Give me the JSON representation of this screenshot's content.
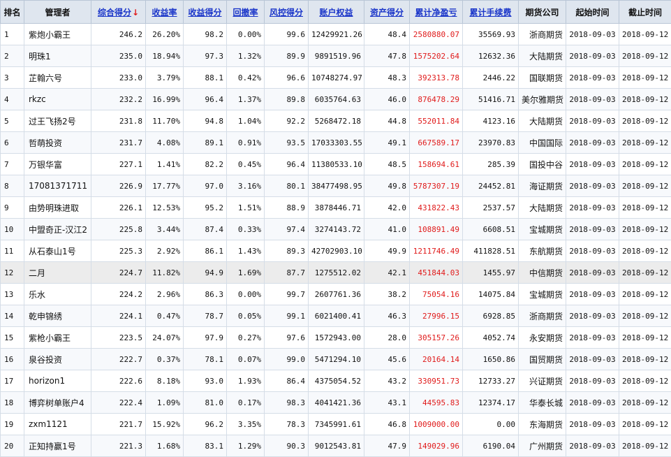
{
  "headers": [
    "排名",
    "管理者",
    "综合得分",
    "收益率",
    "收益得分",
    "回撤率",
    "风控得分",
    "账户权益",
    "资产得分",
    "累计净盈亏",
    "累计手续费",
    "期货公司",
    "起始时间",
    "截止时间"
  ],
  "sort_indicator": "↓",
  "rows": [
    {
      "rank": "1",
      "name": "紫炮小霸王",
      "score": "246.2",
      "ret": "26.20%",
      "ret_score": "98.2",
      "dd": "0.00%",
      "risk": "99.6",
      "equity": "12429921.26",
      "asset": "48.4",
      "pnl": "2580880.07",
      "fee": "35569.93",
      "company": "浙商期货",
      "start": "2018-09-03",
      "end": "2018-09-12"
    },
    {
      "rank": "2",
      "name": "明珠1",
      "score": "235.0",
      "ret": "18.94%",
      "ret_score": "97.3",
      "dd": "1.32%",
      "risk": "89.9",
      "equity": "9891519.96",
      "asset": "47.8",
      "pnl": "1575202.64",
      "fee": "12632.36",
      "company": "大陆期货",
      "start": "2018-09-03",
      "end": "2018-09-12"
    },
    {
      "rank": "3",
      "name": "芷翰六号",
      "score": "233.0",
      "ret": "3.79%",
      "ret_score": "88.1",
      "dd": "0.42%",
      "risk": "96.6",
      "equity": "10748274.97",
      "asset": "48.3",
      "pnl": "392313.78",
      "fee": "2446.22",
      "company": "国联期货",
      "start": "2018-09-03",
      "end": "2018-09-12"
    },
    {
      "rank": "4",
      "name": "rkzc",
      "score": "232.2",
      "ret": "16.99%",
      "ret_score": "96.4",
      "dd": "1.37%",
      "risk": "89.8",
      "equity": "6035764.63",
      "asset": "46.0",
      "pnl": "876478.29",
      "fee": "51416.71",
      "company": "美尔雅期货",
      "start": "2018-09-03",
      "end": "2018-09-12"
    },
    {
      "rank": "5",
      "name": "过王飞扬2号",
      "score": "231.8",
      "ret": "11.70%",
      "ret_score": "94.8",
      "dd": "1.04%",
      "risk": "92.2",
      "equity": "5268472.18",
      "asset": "44.8",
      "pnl": "552011.84",
      "fee": "4123.16",
      "company": "大陆期货",
      "start": "2018-09-03",
      "end": "2018-09-12"
    },
    {
      "rank": "6",
      "name": "哲萌投资",
      "score": "231.7",
      "ret": "4.08%",
      "ret_score": "89.1",
      "dd": "0.91%",
      "risk": "93.5",
      "equity": "17033303.55",
      "asset": "49.1",
      "pnl": "667589.17",
      "fee": "23970.83",
      "company": "中国国际",
      "start": "2018-09-03",
      "end": "2018-09-12"
    },
    {
      "rank": "7",
      "name": "万银华富",
      "score": "227.1",
      "ret": "1.41%",
      "ret_score": "82.2",
      "dd": "0.45%",
      "risk": "96.4",
      "equity": "11380533.10",
      "asset": "48.5",
      "pnl": "158694.61",
      "fee": "285.39",
      "company": "国投中谷",
      "start": "2018-09-03",
      "end": "2018-09-12"
    },
    {
      "rank": "8",
      "name": "17081371711",
      "score": "226.9",
      "ret": "17.77%",
      "ret_score": "97.0",
      "dd": "3.16%",
      "risk": "80.1",
      "equity": "38477498.95",
      "asset": "49.8",
      "pnl": "5787307.19",
      "fee": "24452.81",
      "company": "海证期货",
      "start": "2018-09-03",
      "end": "2018-09-12"
    },
    {
      "rank": "9",
      "name": "由势明珠进取",
      "score": "226.1",
      "ret": "12.53%",
      "ret_score": "95.2",
      "dd": "1.51%",
      "risk": "88.9",
      "equity": "3878446.71",
      "asset": "42.0",
      "pnl": "431822.43",
      "fee": "2537.57",
      "company": "大陆期货",
      "start": "2018-09-03",
      "end": "2018-09-12"
    },
    {
      "rank": "10",
      "name": "中盟奇正-汉江2",
      "score": "225.8",
      "ret": "3.44%",
      "ret_score": "87.4",
      "dd": "0.33%",
      "risk": "97.4",
      "equity": "3274143.72",
      "asset": "41.0",
      "pnl": "108891.49",
      "fee": "6608.51",
      "company": "宝城期货",
      "start": "2018-09-03",
      "end": "2018-09-12"
    },
    {
      "rank": "11",
      "name": "从石泰山1号",
      "score": "225.3",
      "ret": "2.92%",
      "ret_score": "86.1",
      "dd": "1.43%",
      "risk": "89.3",
      "equity": "42702903.10",
      "asset": "49.9",
      "pnl": "1211746.49",
      "fee": "411828.51",
      "company": "东航期货",
      "start": "2018-09-03",
      "end": "2018-09-12"
    },
    {
      "rank": "12",
      "name": "二月",
      "score": "224.7",
      "ret": "11.82%",
      "ret_score": "94.9",
      "dd": "1.69%",
      "risk": "87.7",
      "equity": "1275512.02",
      "asset": "42.1",
      "pnl": "451844.03",
      "fee": "1455.97",
      "company": "中信期货",
      "start": "2018-09-03",
      "end": "2018-09-12"
    },
    {
      "rank": "13",
      "name": "乐水",
      "score": "224.2",
      "ret": "2.96%",
      "ret_score": "86.3",
      "dd": "0.00%",
      "risk": "99.7",
      "equity": "2607761.36",
      "asset": "38.2",
      "pnl": "75054.16",
      "fee": "14075.84",
      "company": "宝城期货",
      "start": "2018-09-03",
      "end": "2018-09-12"
    },
    {
      "rank": "14",
      "name": "乾申锦绣",
      "score": "224.1",
      "ret": "0.47%",
      "ret_score": "78.7",
      "dd": "0.05%",
      "risk": "99.1",
      "equity": "6021400.41",
      "asset": "46.3",
      "pnl": "27996.15",
      "fee": "6928.85",
      "company": "浙商期货",
      "start": "2018-09-03",
      "end": "2018-09-12"
    },
    {
      "rank": "15",
      "name": "紫枪小霸王",
      "score": "223.5",
      "ret": "24.07%",
      "ret_score": "97.9",
      "dd": "0.27%",
      "risk": "97.6",
      "equity": "1572943.00",
      "asset": "28.0",
      "pnl": "305157.26",
      "fee": "4052.74",
      "company": "永安期货",
      "start": "2018-09-03",
      "end": "2018-09-12"
    },
    {
      "rank": "16",
      "name": "泉谷投资",
      "score": "222.7",
      "ret": "0.37%",
      "ret_score": "78.1",
      "dd": "0.07%",
      "risk": "99.0",
      "equity": "5471294.10",
      "asset": "45.6",
      "pnl": "20164.14",
      "fee": "1650.86",
      "company": "国贸期货",
      "start": "2018-09-03",
      "end": "2018-09-12"
    },
    {
      "rank": "17",
      "name": "horizon1",
      "score": "222.6",
      "ret": "8.18%",
      "ret_score": "93.0",
      "dd": "1.93%",
      "risk": "86.4",
      "equity": "4375054.52",
      "asset": "43.2",
      "pnl": "330951.73",
      "fee": "12733.27",
      "company": "兴证期货",
      "start": "2018-09-03",
      "end": "2018-09-12"
    },
    {
      "rank": "18",
      "name": "博弈树单账户4",
      "score": "222.4",
      "ret": "1.09%",
      "ret_score": "81.0",
      "dd": "0.17%",
      "risk": "98.3",
      "equity": "4041421.36",
      "asset": "43.1",
      "pnl": "44595.83",
      "fee": "12374.17",
      "company": "华泰长城",
      "start": "2018-09-03",
      "end": "2018-09-12"
    },
    {
      "rank": "19",
      "name": "zxm1121",
      "score": "221.7",
      "ret": "15.92%",
      "ret_score": "96.2",
      "dd": "3.35%",
      "risk": "78.3",
      "equity": "7345991.61",
      "asset": "46.8",
      "pnl": "1009000.00",
      "fee": "0.00",
      "company": "东海期货",
      "start": "2018-09-03",
      "end": "2018-09-12"
    },
    {
      "rank": "20",
      "name": "正知持赢1号",
      "score": "221.3",
      "ret": "1.68%",
      "ret_score": "83.1",
      "dd": "1.29%",
      "risk": "90.3",
      "equity": "9012543.81",
      "asset": "47.9",
      "pnl": "149029.96",
      "fee": "6190.04",
      "company": "广州期货",
      "start": "2018-09-03",
      "end": "2018-09-12"
    }
  ]
}
